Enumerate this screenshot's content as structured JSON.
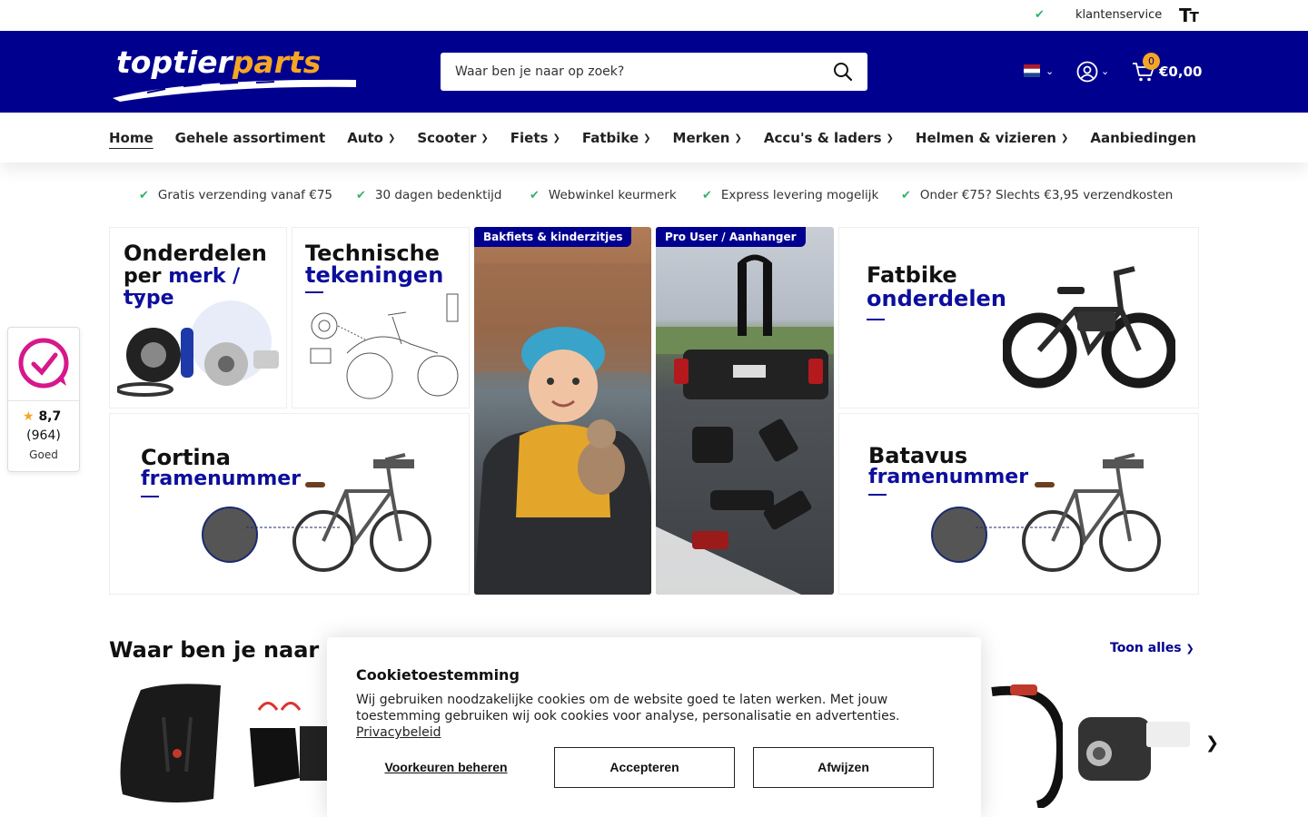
{
  "topbar": {
    "service_label": "klantenservice"
  },
  "header": {
    "logo_text": "toptierparts",
    "search_placeholder": "Waar ben je naar op zoek?",
    "cart_count": "0",
    "cart_total": "€0,00"
  },
  "nav": {
    "items": [
      {
        "label": "Home"
      },
      {
        "label": "Gehele assortiment"
      },
      {
        "label": "Auto"
      },
      {
        "label": "Scooter"
      },
      {
        "label": "Fiets"
      },
      {
        "label": "Fatbike"
      },
      {
        "label": "Merken"
      },
      {
        "label": "Accu's & laders"
      },
      {
        "label": "Helmen & vizieren"
      },
      {
        "label": "Aanbiedingen"
      }
    ]
  },
  "usps": [
    "Gratis verzending vanaf €75",
    "30 dagen bedenktijd",
    "Webwinkel keurmerk",
    "Express levering mogelijk",
    "Onder €75? Slechts €3,95 verzendkosten"
  ],
  "tiles": {
    "t1_line1": "Onderdelen",
    "t1_line2a": "per ",
    "t1_line2b": "merk / type",
    "t2_line1": "Technische",
    "t2_line2": "tekeningen",
    "t3_badge": "Bakfiets & kinderzitjes",
    "t4_badge": "Pro User / Aanhanger",
    "t5_line1": "Fatbike",
    "t5_line2": "onderdelen",
    "t6_line1": "Cortina",
    "t6_line2": "framenummer",
    "t7_line1": "Batavus",
    "t7_line2": "framenummer"
  },
  "review": {
    "score": "8,7",
    "count": "(964)",
    "label": "Goed"
  },
  "section": {
    "title": "Waar ben je naar op z",
    "show_all": "Toon alles"
  },
  "cookie": {
    "title": "Cookietoestemming",
    "text": "Wij gebruiken noodzakelijke cookies om de website goed te laten werken. Met jouw toestemming gebruiken wij ook cookies voor analyse, personalisatie en advertenties.",
    "privacy_link": "Privacybeleid",
    "prefs": "Voorkeuren beheren",
    "accept": "Accepteren",
    "reject": "Afwijzen"
  },
  "colors": {
    "brand_blue": "#00008f",
    "accent_orange": "#f5a623",
    "check_green": "#2fb36a"
  }
}
